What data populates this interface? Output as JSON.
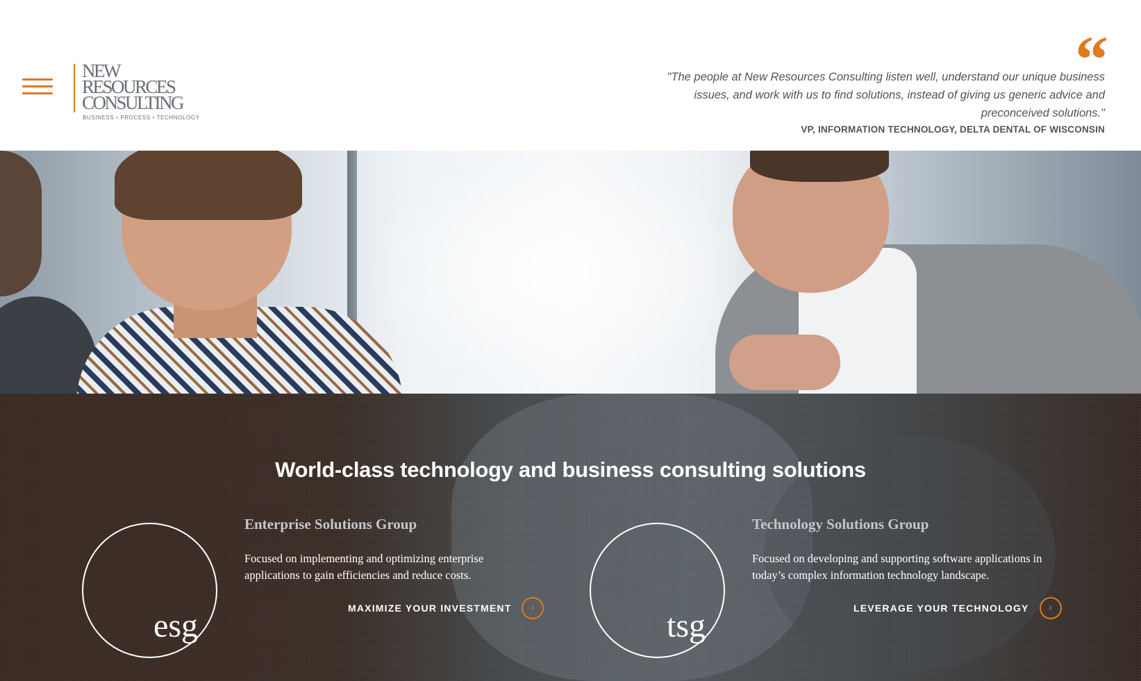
{
  "header": {
    "logo": {
      "line1": "NEW",
      "line2": "RESOURCES",
      "line3": "CONSULTING",
      "tag_business": "BUSINESS",
      "tag_sep": "•",
      "tag_process": "PROCESS",
      "tag_technology": "TECHNOLOGY"
    },
    "quote_mark": "“",
    "quote": "\"The people at New Resources Consulting listen well, understand our unique business issues, and work with us to find solutions, instead of giving us generic advice and preconceived solutions.\"",
    "quote_author": "VP, INFORMATION TECHNOLOGY, DELTA DENTAL OF WISCONSIN"
  },
  "main": {
    "tagline": "World-class technology and business consulting solutions",
    "groups": [
      {
        "abbr": "esg",
        "title": "Enterprise Solutions Group",
        "description": "Focused on implementing and optimizing enterprise applications to gain efficiencies and reduce costs.",
        "cta": "MAXIMIZE YOUR INVESTMENT",
        "cta_icon": "chevron-right-icon"
      },
      {
        "abbr": "tsg",
        "title": "Technology Solutions Group",
        "description": "Focused on developing and supporting software applications in today’s complex information technology landscape.",
        "cta": "LEVERAGE YOUR TECHNOLOGY",
        "cta_icon": "chevron-right-icon"
      }
    ]
  },
  "colors": {
    "accent": "#e07a1f",
    "text_gray": "#4f5458",
    "logo_gray": "#6a6f76",
    "dark_bg": "#3b2e27"
  }
}
